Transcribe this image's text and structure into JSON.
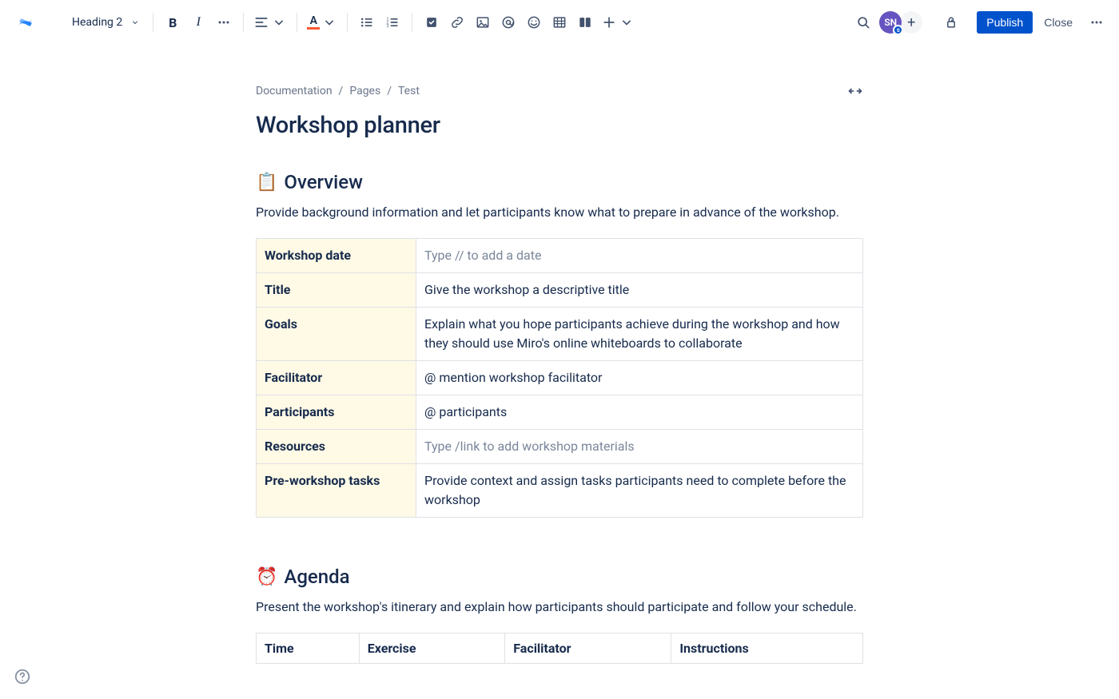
{
  "toolbar": {
    "heading_style": "Heading 2"
  },
  "avatar": {
    "initials": "SN",
    "badge": "s"
  },
  "actions": {
    "publish": "Publish",
    "close": "Close"
  },
  "breadcrumbs": [
    "Documentation",
    "Pages",
    "Test"
  ],
  "page": {
    "title": "Workshop planner"
  },
  "overview": {
    "emoji": "📋",
    "heading": "Overview",
    "description": "Provide background information and let participants know what to prepare in advance of the workshop.",
    "rows": [
      {
        "label": "Workshop date",
        "value": "Type // to add a date",
        "placeholder": true
      },
      {
        "label": "Title",
        "value": "Give the workshop a descriptive title",
        "placeholder": false
      },
      {
        "label": "Goals",
        "value": "Explain what you hope participants achieve during the workshop and how they should use Miro's online whiteboards to collaborate",
        "placeholder": false
      },
      {
        "label": "Facilitator",
        "value": "@ mention workshop facilitator",
        "placeholder": false
      },
      {
        "label": "Participants",
        "value": "@ participants",
        "placeholder": false
      },
      {
        "label": "Resources",
        "value": "Type /link to add workshop materials",
        "placeholder": true
      },
      {
        "label": "Pre-workshop tasks",
        "value": "Provide context and assign tasks participants need to complete before the workshop",
        "placeholder": false
      }
    ]
  },
  "agenda": {
    "emoji": "⏰",
    "heading": "Agenda",
    "description": "Present the workshop's itinerary and explain how participants should participate and follow your schedule.",
    "columns": [
      "Time",
      "Exercise",
      "Facilitator",
      "Instructions"
    ]
  }
}
